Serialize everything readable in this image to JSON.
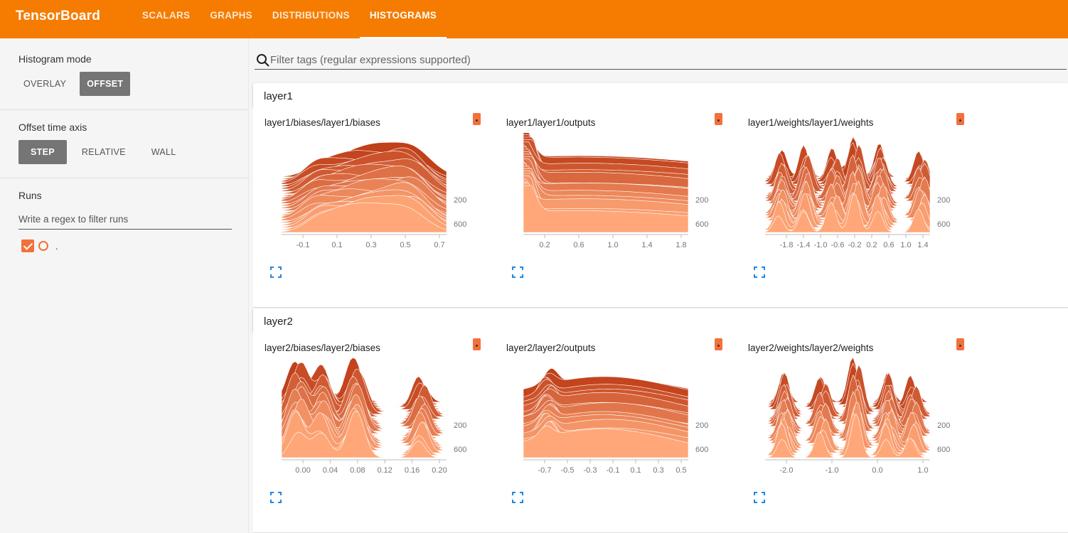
{
  "header": {
    "title": "TensorBoard",
    "tabs": [
      {
        "label": "SCALARS",
        "active": false
      },
      {
        "label": "GRAPHS",
        "active": false
      },
      {
        "label": "DISTRIBUTIONS",
        "active": false
      },
      {
        "label": "HISTOGRAMS",
        "active": true
      }
    ],
    "accent_color": "#f57c00"
  },
  "sidebar": {
    "histogram_mode": {
      "title": "Histogram mode",
      "options": [
        "OVERLAY",
        "OFFSET"
      ],
      "selected": "OFFSET"
    },
    "offset_time_axis": {
      "title": "Offset time axis",
      "options": [
        "STEP",
        "RELATIVE",
        "WALL"
      ],
      "selected": "STEP"
    },
    "runs": {
      "title": "Runs",
      "filter_placeholder": "Write a regex to filter runs",
      "items": [
        {
          "name": ".",
          "checked": true,
          "color": "#f4703a"
        }
      ]
    }
  },
  "main": {
    "filter_placeholder": "Filter tags (regular expressions supported)",
    "categories": [
      {
        "name": "layer1",
        "cards": [
          {
            "title": "layer1/biases/layer1/biases",
            "x_ticks": [
              "-0.1",
              "0.1",
              "0.3",
              "0.5",
              "0.7"
            ],
            "y_ticks": [
              "200",
              "600"
            ]
          },
          {
            "title": "layer1/layer1/outputs",
            "x_ticks": [
              "0.2",
              "0.6",
              "1.0",
              "1.4",
              "1.8"
            ],
            "y_ticks": [
              "200",
              "600"
            ]
          },
          {
            "title": "layer1/weights/layer1/weights",
            "x_ticks": [
              "-1.8",
              "-1.4",
              "-1.0",
              "-0.6",
              "-0.2",
              "0.2",
              "0.6",
              "1.0",
              "1.4"
            ],
            "y_ticks": [
              "200",
              "600"
            ]
          }
        ]
      },
      {
        "name": "layer2",
        "cards": [
          {
            "title": "layer2/biases/layer2/biases",
            "x_ticks": [
              "0.00",
              "0.04",
              "0.08",
              "0.12",
              "0.16",
              "0.20"
            ],
            "y_ticks": [
              "200",
              "600"
            ]
          },
          {
            "title": "layer2/layer2/outputs",
            "x_ticks": [
              "-0.7",
              "-0.5",
              "-0.3",
              "-0.1",
              "0.1",
              "0.3",
              "0.5"
            ],
            "y_ticks": [
              "200",
              "600"
            ]
          },
          {
            "title": "layer2/weights/layer2/weights",
            "x_ticks": [
              "-2.0",
              "-1.0",
              "0.0",
              "1.0"
            ],
            "y_ticks": [
              "200",
              "600"
            ]
          }
        ]
      }
    ]
  },
  "colors": {
    "run": "#f4703a",
    "hist_dark": "#c0401a",
    "hist_light": "#ffa778"
  }
}
